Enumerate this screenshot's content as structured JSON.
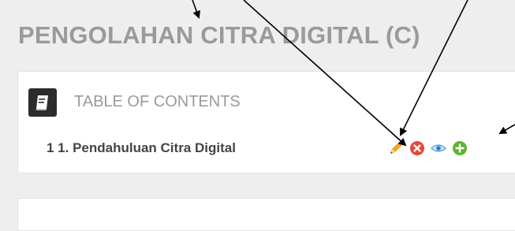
{
  "page": {
    "title": "PENGOLAHAN CITRA DIGITAL (C)"
  },
  "toc": {
    "icon": "book-icon",
    "title": "TABLE OF CONTENTS",
    "chapter": {
      "number": "1",
      "label": "1 1. Pendahuluan Citra Digital"
    },
    "actions": [
      {
        "name": "edit",
        "icon": "pencil-icon",
        "color": "#f0a41c"
      },
      {
        "name": "delete",
        "icon": "close-circle-icon",
        "color": "#e8473b"
      },
      {
        "name": "view",
        "icon": "eye-icon",
        "color": "#4a9fd8"
      },
      {
        "name": "add",
        "icon": "plus-circle-icon",
        "color": "#5cb531"
      }
    ]
  },
  "colors": {
    "background": "#eeeeee",
    "panel": "#ffffff",
    "title_text": "#9a9a9a",
    "chapter_text": "#444444",
    "annotation_arrow": "#000000"
  }
}
